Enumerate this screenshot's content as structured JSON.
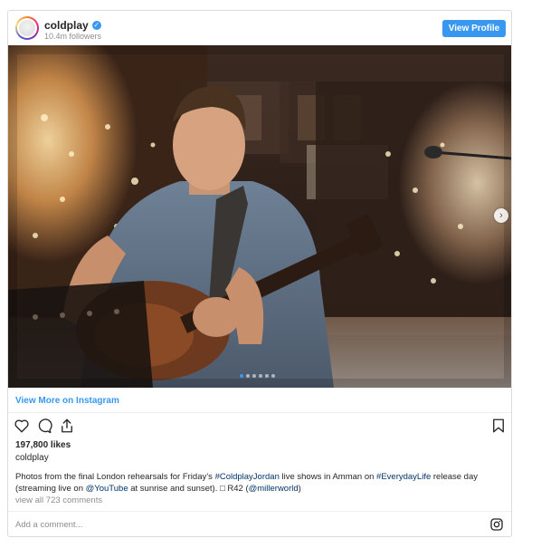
{
  "header": {
    "username": "coldplay",
    "verified_glyph": "✓",
    "followers": "10.4m followers",
    "view_profile_label": "View Profile"
  },
  "media": {
    "description_icon": "photo",
    "next_arrow": "›",
    "dots_count": 6,
    "active_dot": 0
  },
  "view_more": {
    "label": "View More on Instagram"
  },
  "actions": {
    "like_icon": "heart-icon",
    "comment_icon": "comment-icon",
    "share_icon": "share-icon",
    "save_icon": "bookmark-icon"
  },
  "post": {
    "likes": "197,800 likes",
    "caption_user": "coldplay",
    "caption_part1": "Photos from the final London rehearsals for Friday’s ",
    "caption_tag1": "#ColdplayJordan",
    "caption_part2": " live shows in Amman on ",
    "caption_tag2": "#EverydayLife",
    "caption_part3": " release day (streaming live on ",
    "caption_tag3": "@YouTube",
    "caption_part4": " at sunrise and sunset). □ R42 (",
    "caption_tag4": "@millerworld",
    "caption_part5": ")",
    "view_comments": "view all 723 comments"
  },
  "comment_bar": {
    "placeholder": "Add a comment..."
  },
  "colors": {
    "accent": "#3897f0",
    "tag": "#003569",
    "muted": "#8e8e8e"
  }
}
